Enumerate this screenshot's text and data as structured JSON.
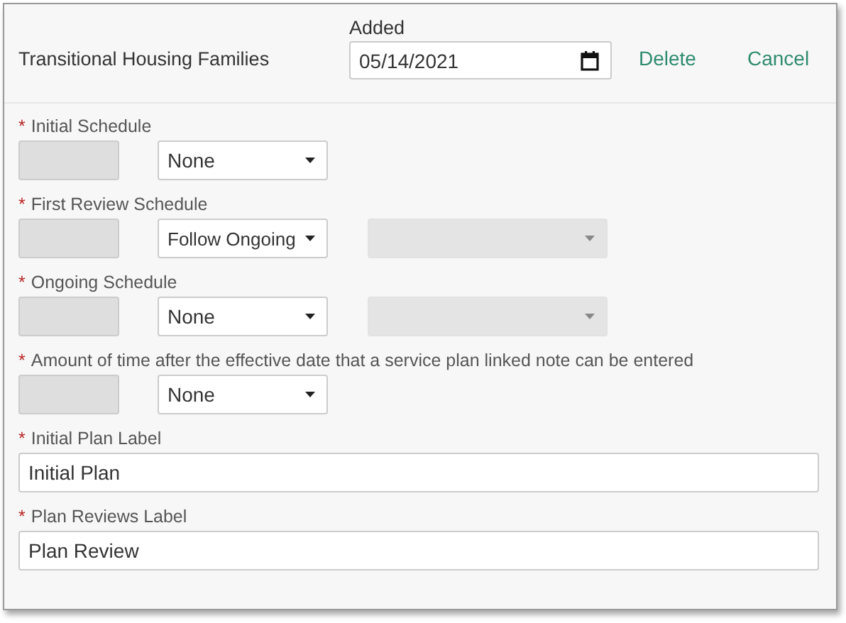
{
  "header": {
    "title": "Transitional Housing Families",
    "date_label": "Added",
    "date_value": "05/14/2021",
    "actions": [
      "Delete",
      "Cancel"
    ]
  },
  "schedules": [
    {
      "label": "Initial Schedule",
      "required_mark": "*",
      "amount": {
        "disabled": true
      },
      "unit": {
        "value": "None",
        "disabled": false
      }
    },
    {
      "label": "First Review Schedule",
      "required_mark": "*",
      "amount": {
        "disabled": true
      },
      "unit": {
        "value": "Follow Ongoing",
        "disabled": false
      },
      "secondary": {
        "disabled": true
      }
    },
    {
      "label": "Ongoing Schedule",
      "required_mark": "*",
      "amount": {
        "disabled": true
      },
      "unit": {
        "value": "None",
        "disabled": false
      },
      "secondary": {
        "disabled": true
      }
    },
    {
      "label": "Amount of time after the effective date that a service plan linked note can be entered",
      "required_mark": "*",
      "amount": {
        "disabled": true
      },
      "unit": {
        "value": "None",
        "disabled": false
      }
    }
  ],
  "labels": [
    {
      "label": "Initial Plan Label",
      "required_mark": "*",
      "value": "Initial Plan"
    },
    {
      "label": "Plan Reviews Label",
      "required_mark": "*",
      "value": "Plan Review"
    }
  ]
}
